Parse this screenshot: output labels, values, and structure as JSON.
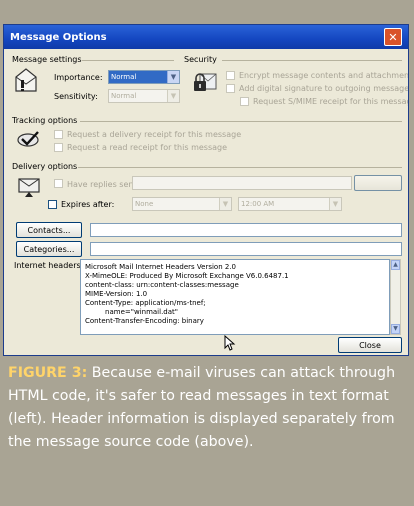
{
  "window": {
    "title": "Message Options",
    "close_glyph": "✕"
  },
  "message_settings": {
    "section_title": "Message settings",
    "importance_label": "Importance:",
    "importance_value": "Normal",
    "sensitivity_label": "Sensitivity:",
    "sensitivity_value": "Normal"
  },
  "security": {
    "section_title": "Security",
    "options": [
      "Encrypt message contents and attachments",
      "Add digital signature to outgoing message",
      "Request S/MIME receipt for this message"
    ]
  },
  "tracking": {
    "section_title": "Tracking options",
    "options": [
      "Request a delivery receipt for this message",
      "Request a read receipt for this message"
    ]
  },
  "delivery": {
    "section_title": "Delivery options",
    "replies_label": "Have replies sent to:",
    "expires_label": "Expires after:",
    "expires_date": "None",
    "expires_time": "12:00 AM"
  },
  "contacts_button": "Contacts...",
  "categories_button": "Categories...",
  "internet_headers_label": "Internet headers:",
  "internet_headers": [
    "Microsoft Mail Internet Headers Version 2.0",
    "X-MimeOLE: Produced By Microsoft Exchange V6.0.6487.1",
    "content-class: urn:content-classes:message",
    "MIME-Version: 1.0",
    "Content-Type: application/ms-tnef;",
    "         name=\"winmail.dat\"",
    "Content-Transfer-Encoding: binary"
  ],
  "close_button": "Close",
  "caption": {
    "figure_label": "FIGURE 3:",
    "text": " Because e-mail viruses can attack through HTML code, it's safer to read messages in text format (left). Header information is displayed separately from the message source code (above)."
  },
  "colors": {
    "title_bar": "#1446c0",
    "dialog_bg": "#ece9d8",
    "page_bg": "#a9a494",
    "figure_label": "#ffd46a"
  }
}
